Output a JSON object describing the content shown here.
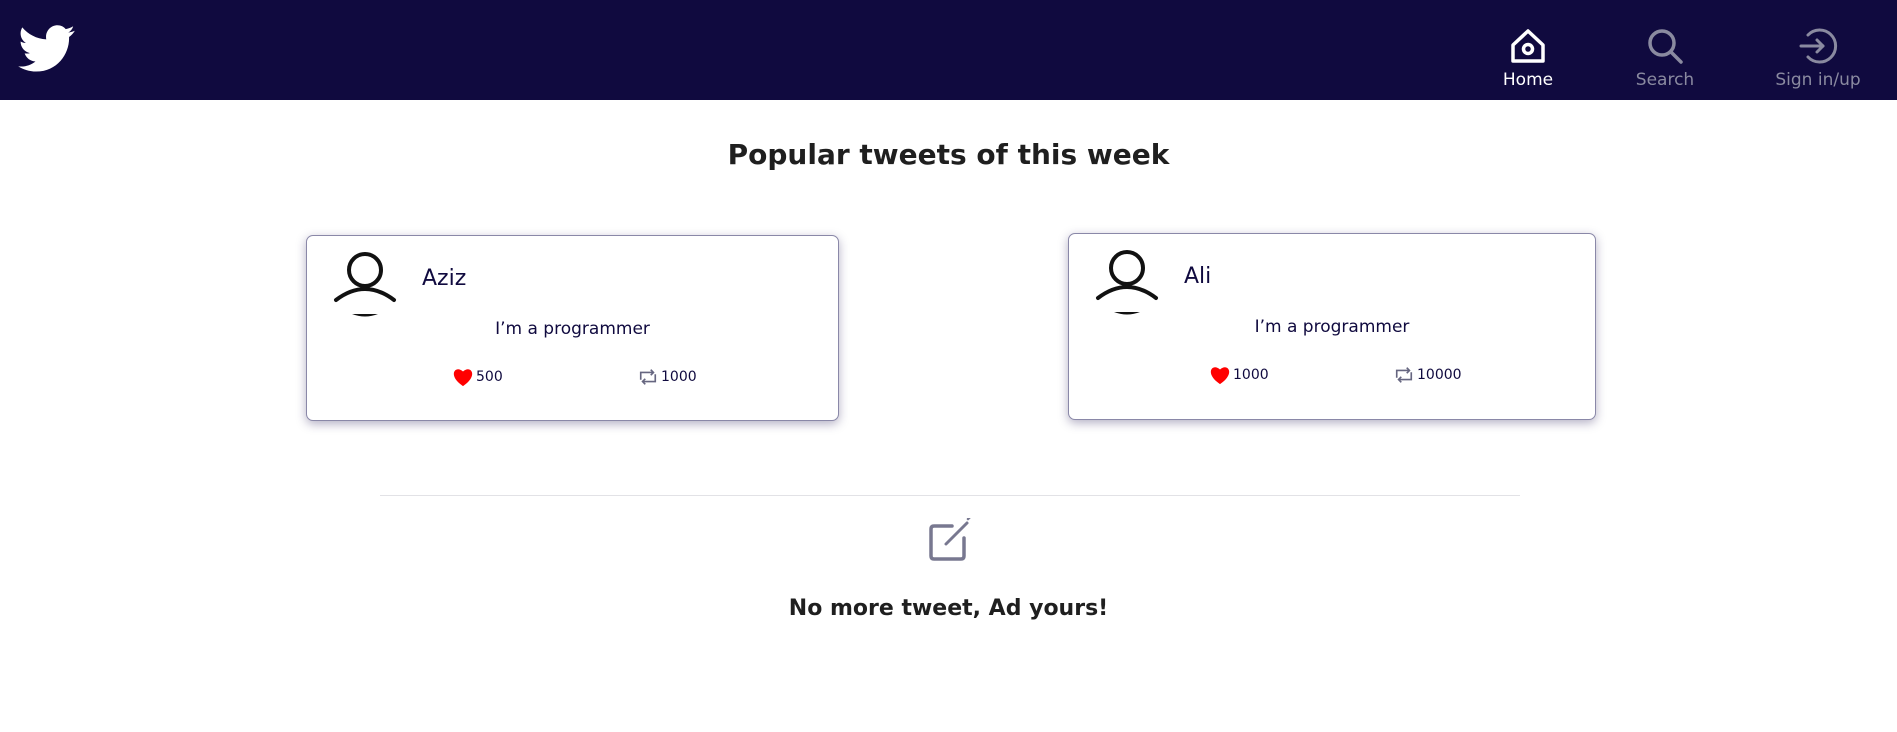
{
  "header": {
    "logo_icon": "twitter-bird-icon",
    "background": "#100a3f",
    "nav": [
      {
        "label": "Home",
        "icon": "home-icon",
        "active": true
      },
      {
        "label": "Search",
        "icon": "search-icon",
        "active": false
      },
      {
        "label": "Sign in/up",
        "icon": "sign-in-icon",
        "active": false
      }
    ]
  },
  "main": {
    "title": "Popular tweets of this week",
    "tweets": [
      {
        "author": "Aziz",
        "avatar_icon": "user-avatar-icon",
        "text": "I’m a programmer",
        "likes": "500",
        "retweets": "1000"
      },
      {
        "author": "Ali",
        "avatar_icon": "user-avatar-icon",
        "text": "I’m a programmer",
        "likes": "1000",
        "retweets": "10000"
      }
    ],
    "compose_icon": "edit-icon",
    "empty_message": "No more tweet, Ad yours!"
  },
  "colors": {
    "heart": "#ff0000",
    "accent": "#100a3f",
    "muted": "#8a8aa0"
  }
}
